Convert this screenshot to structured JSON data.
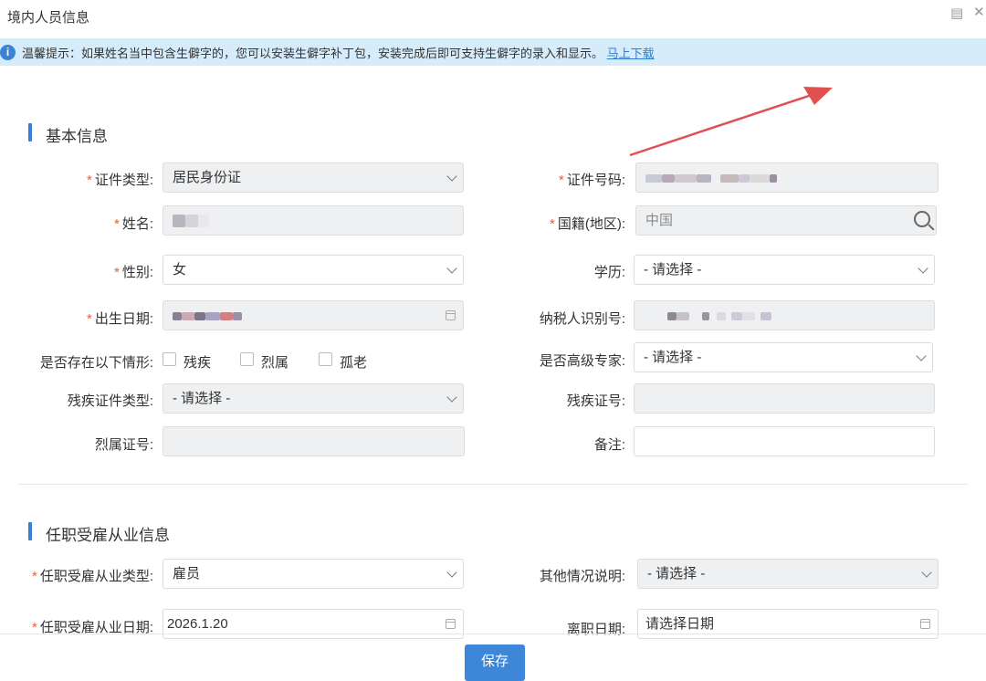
{
  "window": {
    "title": "境内人员信息"
  },
  "notice": {
    "text": "温馨提示：如果姓名当中包含生僻字的，您可以安装生僻字补丁包，安装完成后即可支持生僻字的录入和显示。",
    "link": "马上下载"
  },
  "basic": {
    "title": "基本信息",
    "id_type": {
      "label": "证件类型:",
      "value": "居民身份证"
    },
    "id_number": {
      "label": "证件号码:"
    },
    "name": {
      "label": "姓名:"
    },
    "nationality": {
      "label": "国籍(地区):",
      "value": "中国"
    },
    "gender": {
      "label": "性别:",
      "value": "女"
    },
    "education": {
      "label": "学历:",
      "value": "- 请选择 -"
    },
    "birth_date": {
      "label": "出生日期:"
    },
    "taxpayer_id": {
      "label": "纳税人识别号:"
    },
    "situations": {
      "label": "是否存在以下情形:",
      "options": [
        "残疾",
        "烈属",
        "孤老"
      ]
    },
    "senior_expert": {
      "label": "是否高级专家:",
      "value": "- 请选择 -"
    },
    "disability_cert_type": {
      "label": "残疾证件类型:",
      "value": "- 请选择 -"
    },
    "disability_cert_no": {
      "label": "残疾证号:"
    },
    "martyr_cert_no": {
      "label": "烈属证号:"
    },
    "remarks": {
      "label": "备注:"
    }
  },
  "employment": {
    "title": "任职受雇从业信息",
    "type": {
      "label": "任职受雇从业类型:",
      "value": "雇员"
    },
    "other_note": {
      "label": "其他情况说明:",
      "value": "- 请选择 -"
    },
    "date": {
      "label": "任职受雇从业日期:",
      "value": "2026.1.20"
    },
    "leave_date": {
      "label": "离职日期:",
      "placeholder": "请选择日期"
    }
  },
  "footer": {
    "save": "保存"
  },
  "colors": {
    "accent": "#3d86d8",
    "required": "#e0603a",
    "notice_bg": "#d6ecfb",
    "arrow": "#e05050"
  },
  "icons": [
    "info-icon",
    "maximize-icon",
    "close-icon",
    "chevron-down-icon",
    "calendar-icon",
    "search-icon",
    "annotation-arrow"
  ]
}
